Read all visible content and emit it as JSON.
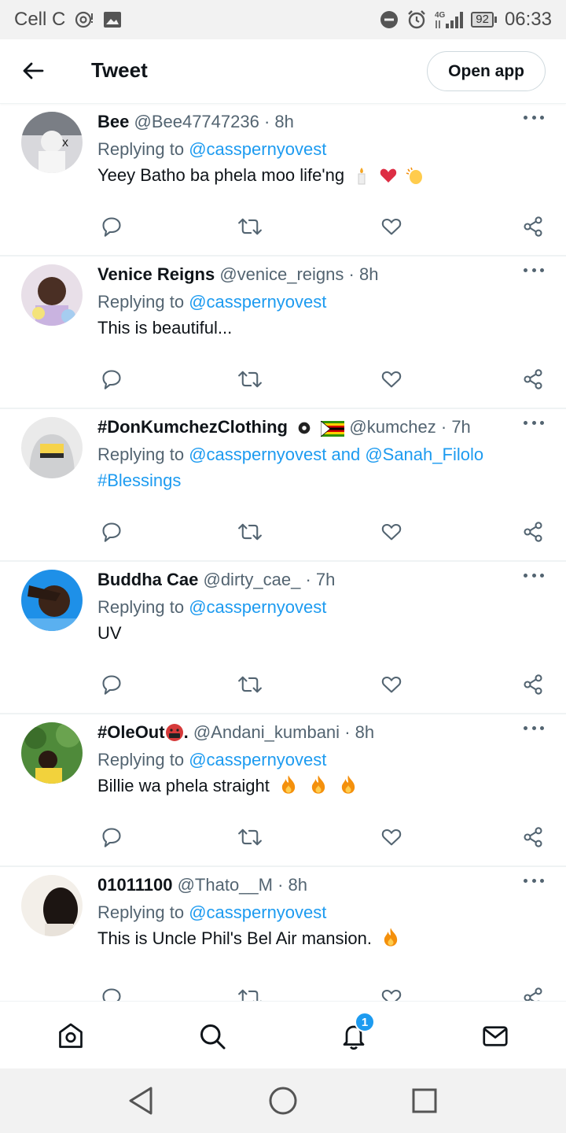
{
  "status_bar": {
    "carrier": "Cell C",
    "network": "4G",
    "battery": "92",
    "time": "06:33"
  },
  "header": {
    "title": "Tweet",
    "open_app_label": "Open app"
  },
  "tweets": [
    {
      "name": "Bee",
      "handle": "@Bee47747236",
      "time": "· 8h",
      "replying_prefix": "Replying to",
      "mentions": "@casspernyovest",
      "text": "Yeey Batho ba phela moo life'ng",
      "text2": "",
      "emojis": [
        "candle",
        "heart",
        "clap"
      ]
    },
    {
      "name": "Venice Reigns",
      "handle": "@venice_reigns",
      "time": "· 8h",
      "replying_prefix": "Replying to",
      "mentions": "@casspernyovest",
      "text": "This is beautiful...",
      "text2": "",
      "emojis": []
    },
    {
      "name": "#DonKumchezClothing",
      "handle": "@kumchez",
      "time": "· 7h",
      "replying_prefix": "Replying to",
      "mentions": "@casspernyovest and @Sanah_Filolo",
      "text": "",
      "text2": "#Blessings",
      "emojis": []
    },
    {
      "name": "Buddha Cae",
      "handle": "@dirty_cae_",
      "time": "· 7h",
      "replying_prefix": "Replying to",
      "mentions": "@casspernyovest",
      "text": "UV",
      "text2": "",
      "emojis": []
    },
    {
      "name": "#OleOut",
      "name_suffix": ".",
      "handle": "@Andani_kumbani",
      "time": "· 8h",
      "replying_prefix": "Replying to",
      "mentions": "@casspernyovest",
      "text": "Billie wa phela straight",
      "text2": "",
      "emojis": [
        "fire",
        "fire",
        "fire"
      ]
    },
    {
      "name": "01011100",
      "handle": "@Thato__M",
      "time": "· 8h",
      "replying_prefix": "Replying to",
      "mentions": "@casspernyovest",
      "text": "This is Uncle Phil's Bel Air mansion.",
      "text2": "",
      "emojis": [
        "fire"
      ]
    }
  ],
  "bottom_nav": {
    "items": [
      "home-icon",
      "search-icon",
      "bell-icon",
      "mail-icon"
    ],
    "notification_count": "1"
  },
  "colors": {
    "accent": "#1d9bf0",
    "text": "#0f1419",
    "muted": "#536471",
    "divider": "#eff3f4"
  }
}
